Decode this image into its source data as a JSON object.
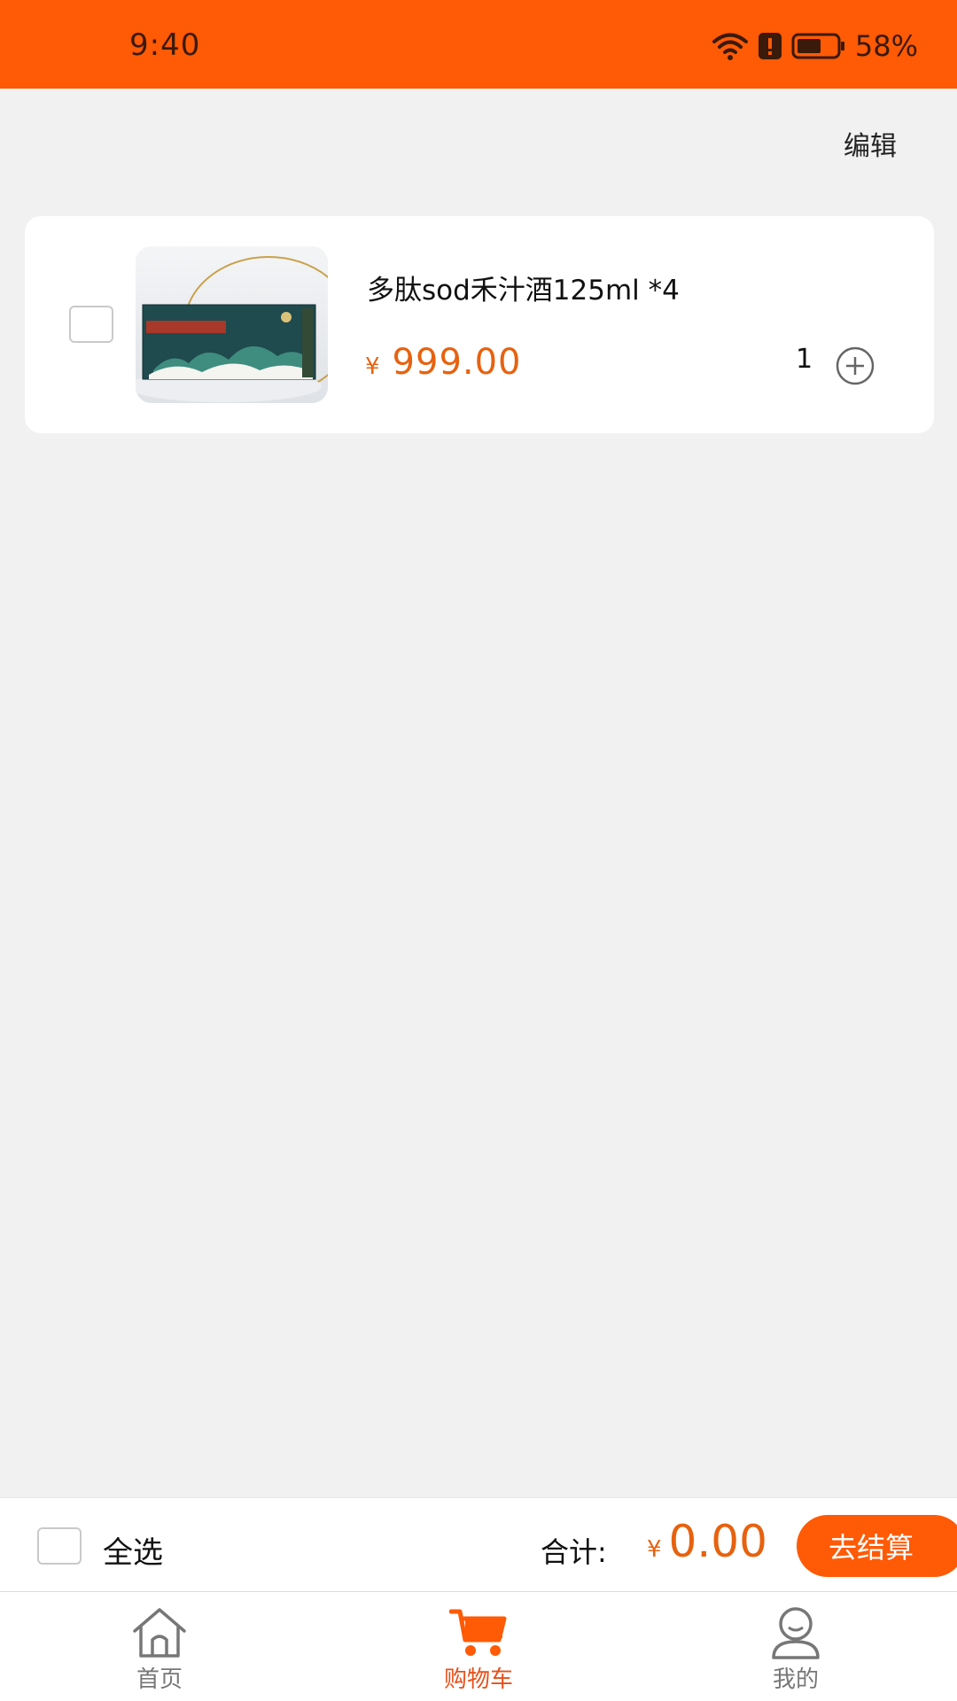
{
  "status_bar": {
    "time": "9:40",
    "battery": "58%",
    "icons": [
      "wifi-icon",
      "alert-icon",
      "battery-icon"
    ]
  },
  "header": {
    "edit_label": "编辑"
  },
  "cart": {
    "items": [
      {
        "title": "多肽sod禾汁酒125ml *4",
        "currency": "¥",
        "price": "999.00",
        "quantity": "1",
        "selected": false
      }
    ]
  },
  "checkout": {
    "select_all_label": "全选",
    "total_label": "合计:",
    "currency": "¥",
    "total": "0.00",
    "checkout_label": "去结算"
  },
  "nav": {
    "items": [
      {
        "label": "首页",
        "icon": "home-icon",
        "active": false
      },
      {
        "label": "购物车",
        "icon": "cart-icon",
        "active": true
      },
      {
        "label": "我的",
        "icon": "user-icon",
        "active": false
      }
    ]
  },
  "colors": {
    "accent": "#ff5a05",
    "price": "#e7620f",
    "background": "#f1f1f1"
  }
}
